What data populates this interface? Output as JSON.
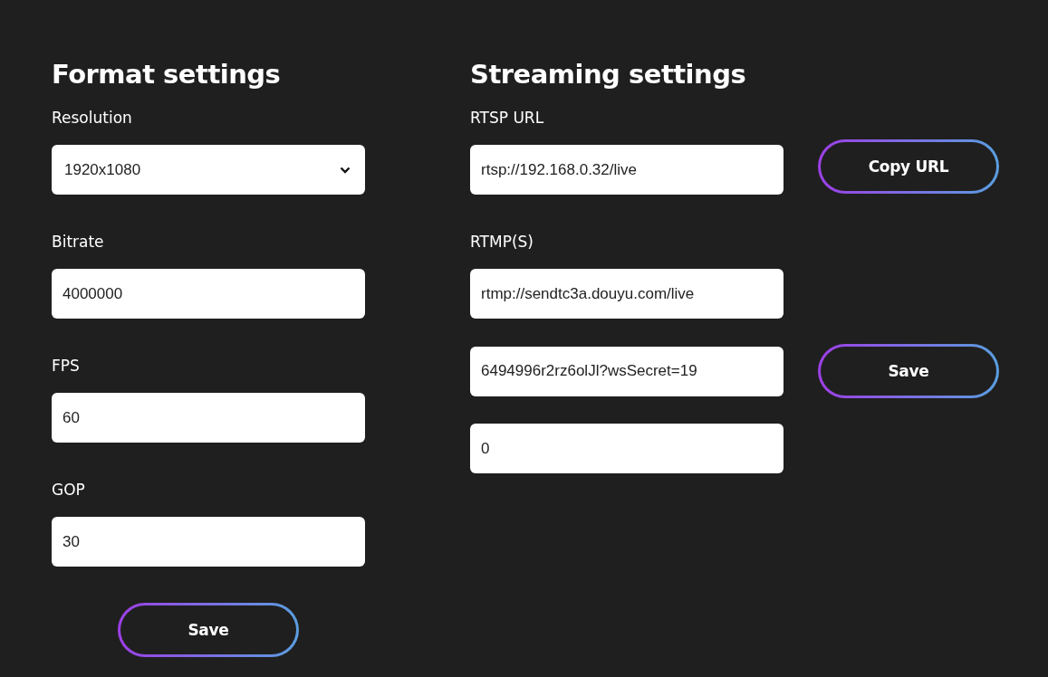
{
  "format_settings": {
    "title": "Format settings",
    "fields": [
      {
        "kind": "select",
        "label": "Resolution",
        "value": "1920x1080"
      },
      {
        "kind": "text",
        "label": "Bitrate",
        "value": "4000000"
      },
      {
        "kind": "text",
        "label": "FPS",
        "value": "60"
      },
      {
        "kind": "text",
        "label": "GOP",
        "value": "30"
      }
    ],
    "button": "Save"
  },
  "streaming_settings": {
    "title": "Streaming settings",
    "rtsp": {
      "label": "RTSP URL",
      "value": "rtsp://192.168.0.32/live",
      "button": "Copy URL"
    },
    "rtmp": {
      "label": "RTMP(S)",
      "values": [
        "rtmp://sendtc3a.douyu.com/live",
        "6494996r2rz6olJl?wsSecret=19",
        "0"
      ],
      "button": "Save"
    }
  }
}
